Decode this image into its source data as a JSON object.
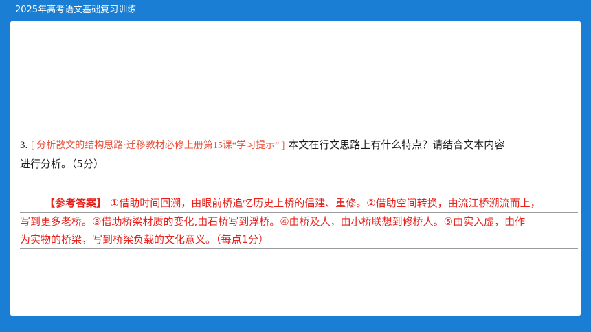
{
  "header": {
    "title": "2025年高考语文基础复习训练"
  },
  "question": {
    "number": "3.",
    "tag": "[ 分析散文的结构思路·迁移教材必修上册第15课“学习提示” ]",
    "text_line1": " 本文在行文思路上有什么特点？请结合文本内容",
    "text_line2": "进行分析。（5分）"
  },
  "answer": {
    "label": "【参考答案】",
    "line1": " ①借助时间回溯，由眼前桥追忆历史上桥的倡建、重修。②借助空间转换，由流江桥溯流而上，",
    "line2": "写到更多老桥。③借助桥梁材质的变化,由石桥写到浮桥。④由桥及人，由小桥联想到修桥人。⑤由实入虚，由作",
    "line3": "为实物的桥梁，写到桥梁负载的文化意义。（每点1分）"
  }
}
